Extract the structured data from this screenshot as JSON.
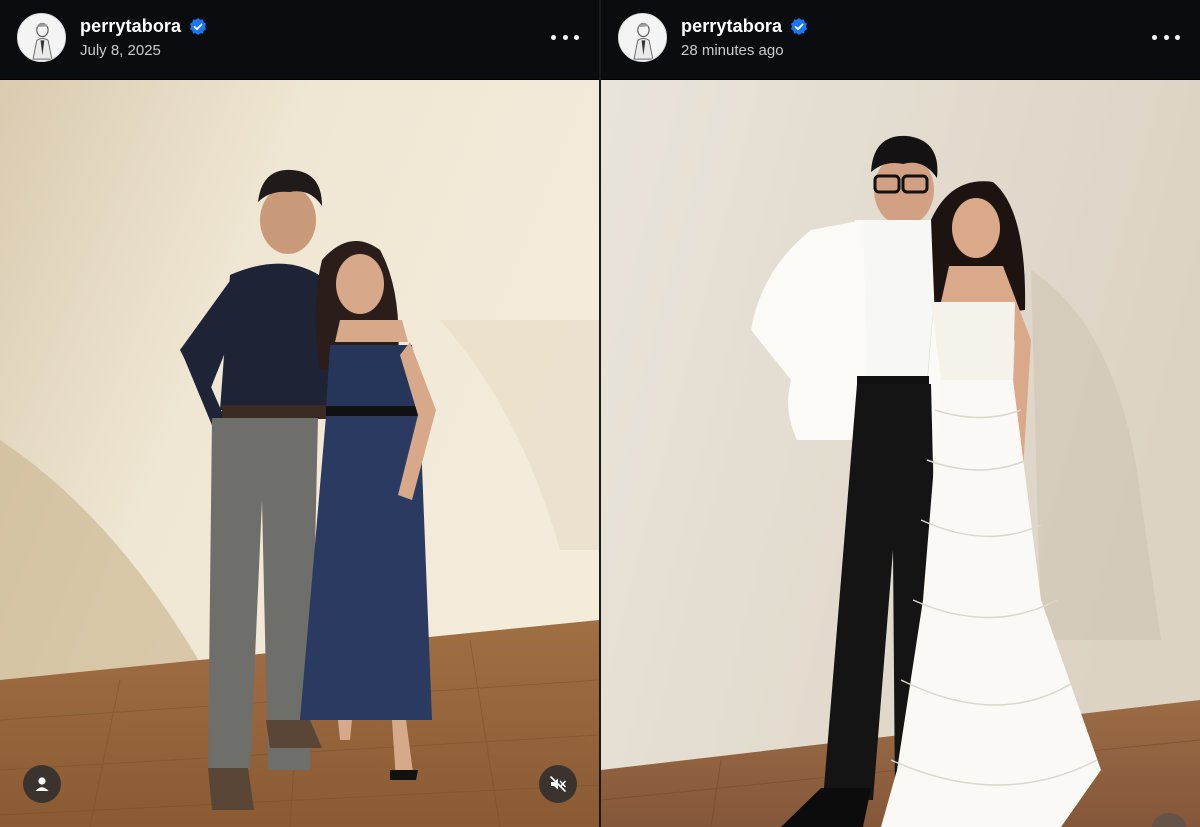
{
  "posts": [
    {
      "username": "perrytabora",
      "timestamp": "July 8, 2025",
      "verified": true,
      "photo_description_icon": "photo",
      "buttons": {
        "tag": "person-icon",
        "mute": "muted-speaker-icon"
      }
    },
    {
      "username": "perrytabora",
      "timestamp": "28 minutes ago",
      "verified": true,
      "photo_description_icon": "photo"
    }
  ],
  "colors": {
    "header_bg": "#0b0c10",
    "verified_blue": "#1877f2",
    "text_primary": "#ffffff",
    "text_secondary": "#c9cbd0"
  }
}
